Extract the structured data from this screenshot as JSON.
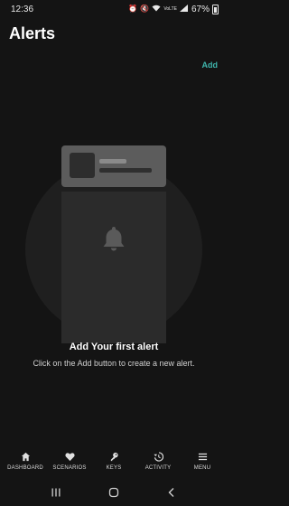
{
  "status_bar": {
    "time": "12:36",
    "signal_text": "VoLTE",
    "battery_percent": "67%"
  },
  "header": {
    "title": "Alerts",
    "add_label": "Add"
  },
  "empty_state": {
    "title": "Add Your first alert",
    "subtitle": "Click on the Add button to create a new alert."
  },
  "bottom_nav": {
    "items": [
      {
        "label": "DASHBOARD",
        "icon": "home-icon"
      },
      {
        "label": "SCENARIOS",
        "icon": "heart-icon"
      },
      {
        "label": "KEYS",
        "icon": "key-icon"
      },
      {
        "label": "ACTIVITY",
        "icon": "history-icon"
      },
      {
        "label": "MENU",
        "icon": "menu-icon"
      }
    ]
  },
  "system_nav": {
    "buttons": [
      "recents-icon",
      "home-button-icon",
      "back-icon"
    ]
  },
  "colors": {
    "accent": "#3fb6ad",
    "background": "#141414"
  }
}
